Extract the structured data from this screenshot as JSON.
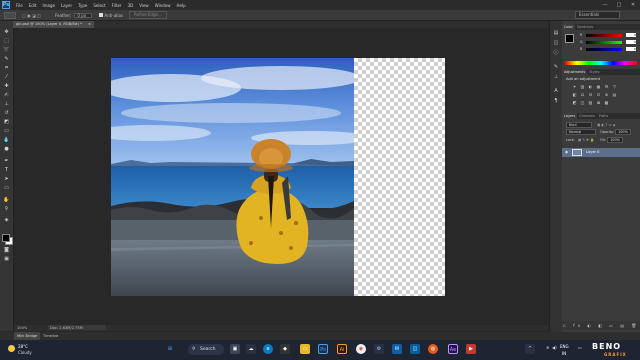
{
  "app": {
    "logo": "Ps"
  },
  "menu": [
    "File",
    "Edit",
    "Image",
    "Layer",
    "Type",
    "Select",
    "Filter",
    "3D",
    "View",
    "Window",
    "Help"
  ],
  "window_controls": [
    "—",
    "□",
    "✕"
  ],
  "options_bar": {
    "feather_label": "Feather:",
    "feather_value": "0 px",
    "antialias_label": "Anti-alias",
    "refine_label": "Refine Edge...",
    "workspace": "Essentials"
  },
  "document_tab": {
    "title": "gkl.psd @ 100% (Layer 0, RGB/8#) *",
    "close": "×"
  },
  "status": {
    "zoom": "100%",
    "doc": "Doc: 2.63M/2.75M"
  },
  "bottom_tabs": [
    "Mini Bridge",
    "Timeline"
  ],
  "panels": {
    "color_tabs": [
      "Color",
      "Swatches"
    ],
    "channels": [
      {
        "label": "R",
        "value": "0"
      },
      {
        "label": "G",
        "value": "0"
      },
      {
        "label": "B",
        "value": "0"
      }
    ],
    "adjust_tabs": [
      "Adjustments",
      "Styles"
    ],
    "adjust_title": "Add an adjustment",
    "adjust_icons_row1": [
      "☀",
      "▥",
      "◐",
      "▦",
      "⚙",
      "▽"
    ],
    "adjust_icons_row2": [
      "◧",
      "⚖",
      "⊟",
      "⊡",
      "⊕",
      "▤"
    ],
    "adjust_icons_row3": [
      "◩",
      "◫",
      "▨",
      "⊠",
      "▩"
    ],
    "layers_tabs": [
      "Layers",
      "Channels",
      "Paths"
    ],
    "kind_label": "Kind",
    "blend_mode": "Normal",
    "opacity_label": "Opacity:",
    "opacity_value": "100%",
    "lock_label": "Lock:",
    "fill_label": "Fill:",
    "fill_value": "100%",
    "layer_name": "Layer 0",
    "layer_footer": "⊂ fx ◐ ◧ ▭ ▤ 🗑"
  },
  "taskbar": {
    "temperature": "28°C",
    "condition": "Cloudy",
    "search": "Search",
    "lang1": "ENG",
    "lang2": "IN"
  },
  "branding": {
    "name": "BENO",
    "sub": "GRAFIX"
  },
  "colors": {
    "accent": "#4a6fa5",
    "layer_selected": "#5b6f8c",
    "taskbar": "#1f2433"
  }
}
